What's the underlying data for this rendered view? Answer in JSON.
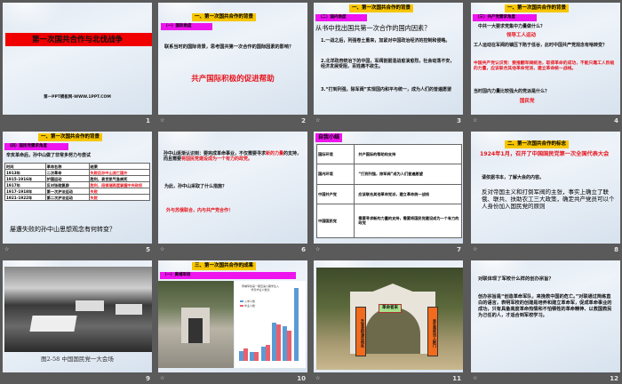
{
  "slides": [
    {
      "number": "1",
      "title": "第一次国共合作与北伐战争",
      "footer": "第一PPT模板网-WWW.1PPT.COM"
    },
    {
      "number": "2",
      "header": "一、第一次国共合作的背景",
      "section": "（一）国际角度",
      "question": "联系当时的国际背景，思考国共第一次合作的国际因素的影响？",
      "answer": "共产国际积极的促进帮助"
    },
    {
      "number": "3",
      "header": "一、第一次国共合作的背景",
      "section": "（二）国内角度",
      "question": "从书中找出国共第一次合作的国内因素？",
      "items": [
        "1.一战之后，列强卷土重来，加紧对中国政治经济的控制和侵略。",
        "2.北洋政府统治下的中国，军阀割据混战愈演愈烈，社会动荡不安，经济发展受阻，百姓痛不欲生。",
        "3.“打到列强，除军阀”实现国内和平与统一，成为人们的普遍愿望"
      ]
    },
    {
      "number": "4",
      "header": "一、第一次国共合作的背景",
      "section": "（三）共产党需求角度",
      "q1": "中共一大要求党集中力量做什么？",
      "a1": "领导工人运动",
      "q2": "工人运动在军阀的镇压下陷于低谷，此时中国共产党观念有啥转变？",
      "a2": "中国共产党认识到：要推翻军阀统治，取得革命的成功，不能只靠工人阶级的力量，应该联合其他革命党派，建立革命统一战线。",
      "q3": "当时国内力量比较强大的党派是什么？",
      "a3": "国民党"
    },
    {
      "number": "5",
      "header": "一、第一次国共合作的背景",
      "section": "（四）国民党需求角度",
      "intro": "辛亥革命后，孙中山做了非常多努力与尝试",
      "columns": [
        "时间",
        "革命名称",
        "结果"
      ],
      "rows": [
        [
          "1913年",
          "二次革命",
          "失败后孙中山流亡国外"
        ],
        [
          "1915-1916年",
          "护国运动",
          "胜利，袁世凯气急病死"
        ],
        [
          "1917年",
          "反对张勋复辟",
          "胜利，段祺瑞再度掌握中央政权"
        ],
        [
          "1917-1918年",
          "第一次护法运动",
          "失败"
        ],
        [
          "1921-1922年",
          "第二次护法运动",
          "失败"
        ]
      ],
      "question": "屡遭失败的孙中山思想观念有何转变？"
    },
    {
      "number": "6",
      "text_a": "孙中山逐渐认识到：要完成革命事业，不仅需要寻求",
      "text_b": "新的力量",
      "text_c": "的支持，而且需要",
      "text_d": "将国民党建设成为一个有力的政党。",
      "question": "为此，孙中山采取了什么措施？",
      "answer": "外与苏俄联合，内与共产党合作！"
    },
    {
      "number": "7",
      "section": "自我小结",
      "rows": [
        [
          "国际环境",
          "共产国际的帮助和支持"
        ],
        [
          "国内环境",
          "“打到列强，除军阀”成为人们普遍愿望"
        ],
        [
          "中国共产党",
          "应该联合其他革命党派，建立革命统一战线"
        ],
        [
          "中国国民党",
          "需要寻求新的力量的支持，需要将国民党建设成为一个有力的政党"
        ]
      ]
    },
    {
      "number": "8",
      "header": "二、第一次国共合作的标志",
      "headline": "1924年1月，召开了中国国民党第一次全国代表大会",
      "prompt": "请依据书本，了解大会的内容。",
      "body": "反对帝国主义和打倒军阀的主张，事实上确立了联俄、联共、扶助农工三大政策，确定共产党员可以个人身份加入国民党的原则"
    },
    {
      "number": "9",
      "caption": "图2-58 中国国民党一大会场"
    },
    {
      "number": "10",
      "header": "三、第一次国共合作的成果",
      "section": "（一）黄埔军校",
      "chart": {
        "title": "黄埔军校第一期至第六期学生入学及毕业人数表",
        "legend": [
          "入学人数",
          "毕业人数"
        ],
        "series": [
          {
            "name": "入学人数",
            "color": "#5b9bd5",
            "values": [
              14,
              12,
              20,
              52,
              48,
              100
            ]
          },
          {
            "name": "毕业人数",
            "color": "#e8606d",
            "values": [
              17,
              12,
              22,
              50,
              42,
              0
            ]
          }
        ]
      }
    },
    {
      "number": "11",
      "sign": "革命者来",
      "left": "升官发财请往他处",
      "right": "贪生畏死勿入斯门"
    },
    {
      "number": "12",
      "question": "对联体现了军校什么样的创办宗旨？",
      "answer": "创办宗旨是“创造革命军队，来挽救中国的危亡。”对联通过简练直白的语言，表明军校的创建是培养和建立革命军，促成革命事业的成功，只有具备高度革命热情和不怕牺牲的革命精神、以救国救民为己任的人，才适合到军校学习。"
    }
  ]
}
